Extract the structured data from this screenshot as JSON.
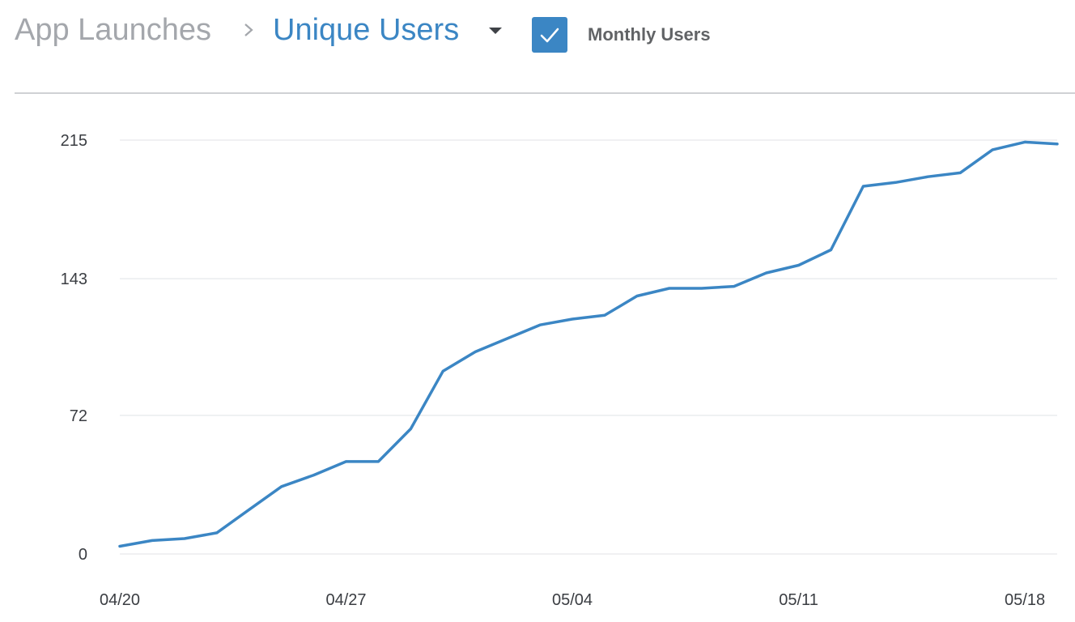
{
  "breadcrumb": {
    "root": "App Launches",
    "current": "Unique Users"
  },
  "toggle": {
    "label": "Monthly Users",
    "checked": true
  },
  "colors": {
    "accent": "#3b86c4",
    "muted_text": "#a4a7ac",
    "grid": "#e6e8eb"
  },
  "chart_data": {
    "type": "line",
    "title": "",
    "xlabel": "",
    "ylabel": "",
    "grid": true,
    "ylim": [
      0,
      215
    ],
    "yticks": [
      0,
      72,
      143,
      215
    ],
    "x_ticks": [
      "04/20",
      "04/27",
      "05/04",
      "05/11",
      "05/18"
    ],
    "series": [
      {
        "x": [
          "04/20",
          "04/21",
          "04/22",
          "04/23",
          "04/24",
          "04/25",
          "04/26",
          "04/27",
          "04/28",
          "04/29",
          "04/30",
          "05/01",
          "05/02",
          "05/03",
          "05/04",
          "05/05",
          "05/06",
          "05/07",
          "05/08",
          "05/09",
          "05/10",
          "05/11",
          "05/12",
          "05/13",
          "05/14",
          "05/15",
          "05/16",
          "05/17",
          "05/18",
          "05/19"
        ],
        "values": [
          4,
          7,
          8,
          11,
          23,
          35,
          41,
          48,
          48,
          65,
          95,
          105,
          112,
          119,
          122,
          124,
          134,
          138,
          138,
          139,
          146,
          150,
          158,
          191,
          193,
          196,
          198,
          210,
          214,
          213
        ]
      }
    ]
  }
}
